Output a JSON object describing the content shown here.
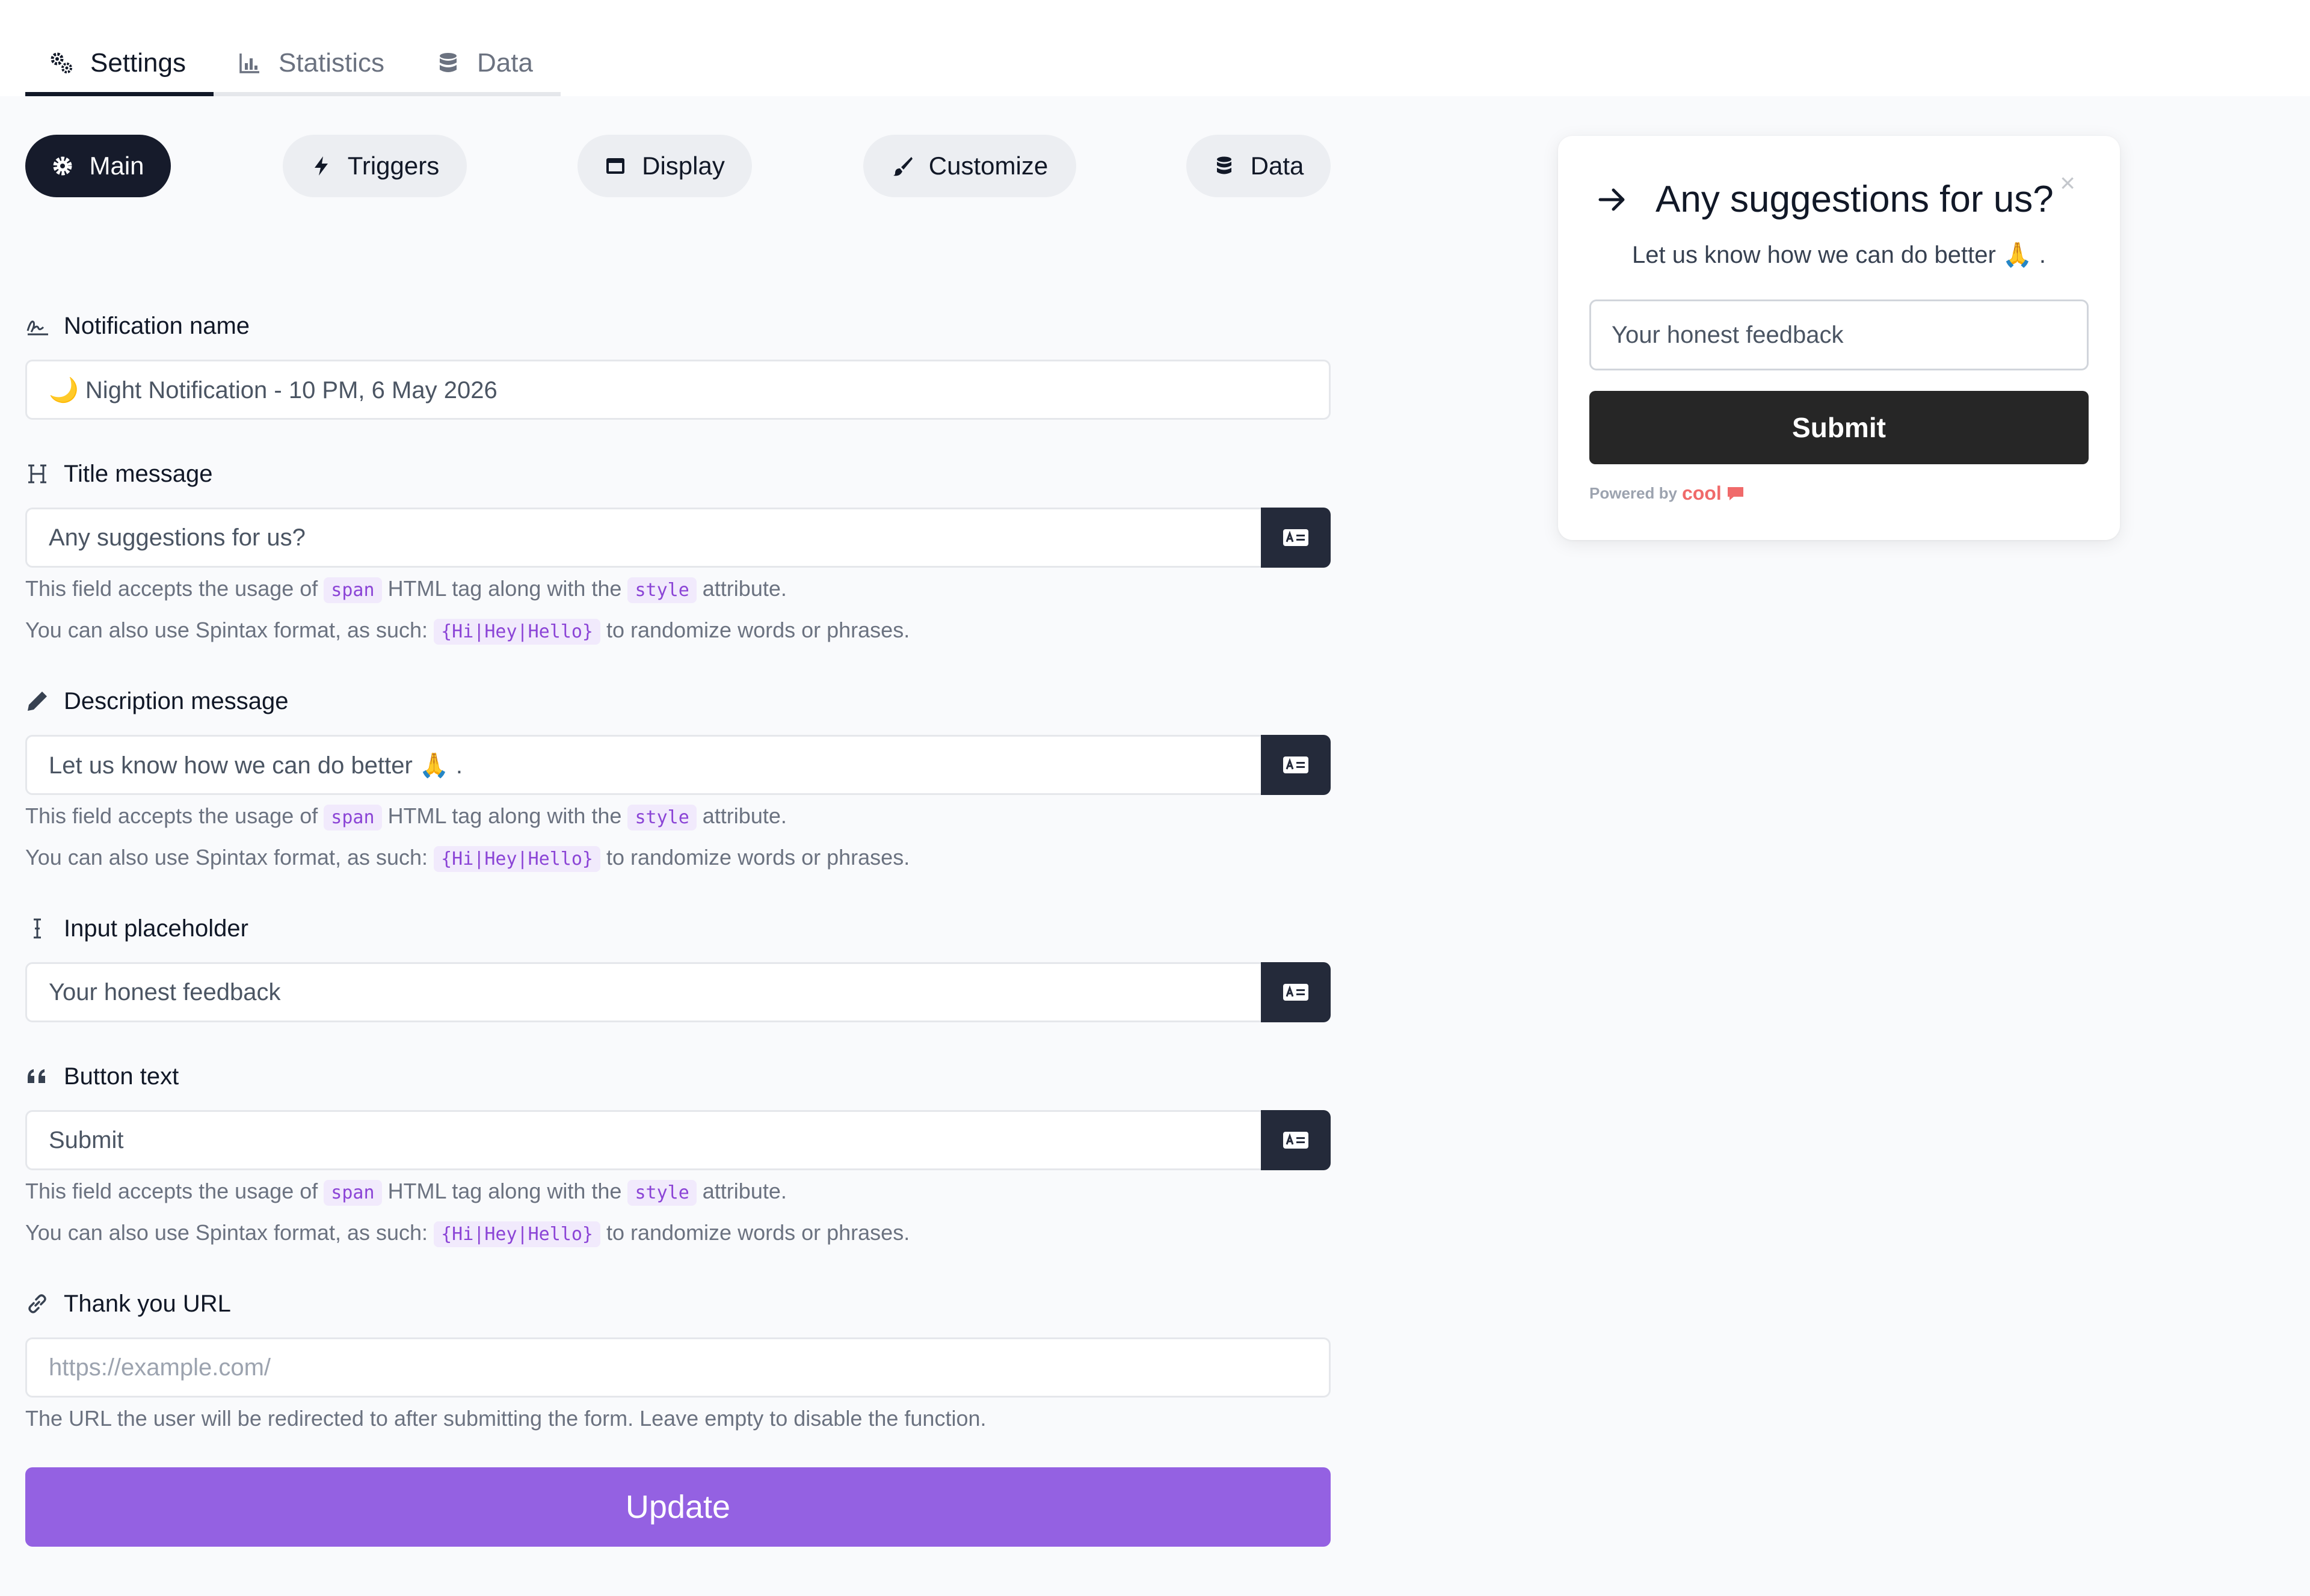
{
  "tabs": [
    {
      "label": "Settings",
      "icon": "gears-icon"
    },
    {
      "label": "Statistics",
      "icon": "chart-icon"
    },
    {
      "label": "Data",
      "icon": "database-icon"
    }
  ],
  "pills": [
    {
      "label": "Main",
      "icon": "gear-icon"
    },
    {
      "label": "Triggers",
      "icon": "bolt-icon"
    },
    {
      "label": "Display",
      "icon": "window-icon"
    },
    {
      "label": "Customize",
      "icon": "paintbrush-icon"
    },
    {
      "label": "Data",
      "icon": "database-icon"
    }
  ],
  "fields": {
    "name": {
      "label": "Notification name",
      "value": "🌙 Night Notification - 10 PM, 6 May 2026"
    },
    "title": {
      "label": "Title message",
      "value": "Any suggestions for us?"
    },
    "description": {
      "label": "Description message",
      "value": "Let us know how we can do better 🙏 ."
    },
    "placeholder": {
      "label": "Input placeholder",
      "value": "Your honest feedback"
    },
    "button": {
      "label": "Button text",
      "value": "Submit"
    },
    "url": {
      "label": "Thank you URL",
      "placeholder": "https://example.com/",
      "help": "The URL the user will be redirected to after submitting the form. Leave empty to disable the function."
    }
  },
  "help": {
    "line1_a": "This field accepts the usage of",
    "line1_code1": "span",
    "line1_b": "HTML tag along with the",
    "line1_code2": "style",
    "line1_c": "attribute.",
    "line2_a": "You can also use Spintax format, as such:",
    "line2_code": "{Hi|Hey|Hello}",
    "line2_b": "to randomize words or phrases."
  },
  "update_label": "Update",
  "preview": {
    "close": "×",
    "title": "Any suggestions for us?",
    "description": "Let us know how we can do better 🙏 .",
    "input_placeholder": "Your honest feedback",
    "submit": "Submit",
    "powered_by": "Powered by",
    "brand": "cool"
  },
  "colors": {
    "accent": "#9461e2",
    "dark": "#161b2b",
    "code_text": "#8b44d6",
    "brand": "#f06a6a"
  }
}
